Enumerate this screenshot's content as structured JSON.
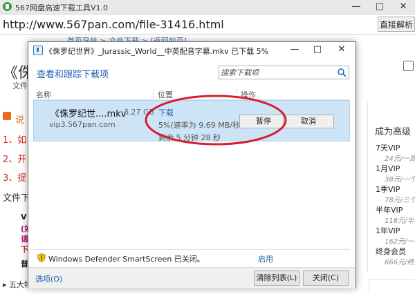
{
  "app": {
    "title": "567网盘高速下载工具V1.0",
    "controls": {
      "minimize": "—",
      "maximize": "□",
      "close": "✕"
    }
  },
  "address_bar": {
    "url": "http://www.567pan.com/file-31416.html",
    "parse_button": "直接解析"
  },
  "background_page": {
    "nav": "  首页导航 > 文件下载 > [返回前页]",
    "big_quote": "《侏",
    "wen_label": "文件",
    "shuo_label": "说",
    "red_lines": [
      "1、如",
      "2、开",
      "3、提"
    ],
    "file_dl_label": "文件下",
    "small_lines": [
      {
        "text": "V",
        "color": "#222222"
      },
      {
        "text": "(如",
        "color": "#b3127a"
      },
      {
        "text": "请",
        "color": "#b3127a"
      },
      {
        "text": "下",
        "color": "#d9251d"
      },
      {
        "text": "普",
        "color": "#222222"
      }
    ],
    "bottom_label": "▸ 五大特",
    "right_panel": {
      "heading": "成为高级",
      "vip_items": [
        {
          "name": "7天VIP",
          "price": "24元/一周"
        },
        {
          "name": "1月VIP",
          "price": "38元/一个"
        },
        {
          "name": "1季VIP",
          "price": "78元/三个"
        },
        {
          "name": "半年VIP",
          "price": "118元/半年"
        },
        {
          "name": "1年VIP",
          "price": "162元/一年"
        },
        {
          "name": "终身会员",
          "price": "666元/终身"
        }
      ]
    }
  },
  "download_dialog": {
    "title": "《侏罗纪世界》_Jurassic_World__中英配音字幕.mkv 已下载 5%",
    "heading": "查看和跟踪下载项",
    "search_placeholder": "搜索下载项",
    "columns": [
      "名称",
      "位置",
      "操作"
    ],
    "item": {
      "file_name": "《侏罗纪世....mkv",
      "size": "3.27 GB",
      "host": "vip3.567pan.com",
      "status": "下载",
      "progress_text": "5%(速率为 9.69 MB/秒)",
      "remaining": "剩余 5 分钟 28 秒",
      "percent": 5,
      "pause_label": "暂停",
      "cancel_label": "取消"
    },
    "smartscreen": {
      "text": "Windows Defender SmartScreen 已关闭。",
      "enable_link": "启用"
    },
    "footer": {
      "options_link": "选项(O)",
      "clear_list_button": "清除列表(L)",
      "close_button": "关闭(C)"
    },
    "controls": {
      "minimize": "—",
      "maximize": "□",
      "close": "✕"
    }
  },
  "colors": {
    "accent_blue": "#1c5fb0",
    "row_selected": "#cde4f7",
    "annotation_red": "#d2202f",
    "page_red": "#d9251d",
    "page_orange": "#e86a1e"
  }
}
